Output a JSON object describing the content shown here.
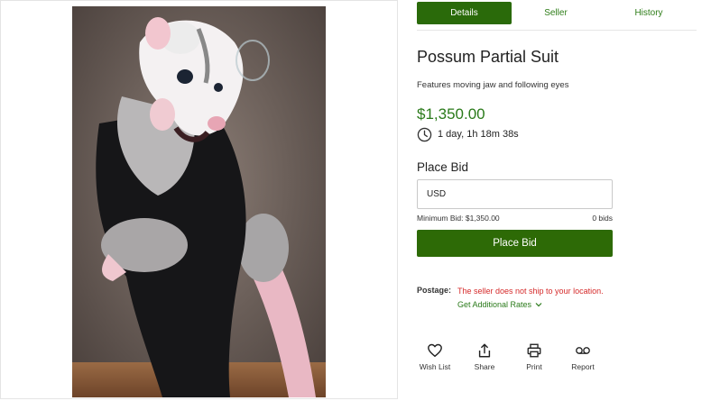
{
  "tabs": [
    {
      "label": "Details",
      "active": true
    },
    {
      "label": "Seller",
      "active": false
    },
    {
      "label": "History",
      "active": false
    }
  ],
  "listing": {
    "title": "Possum Partial Suit",
    "description": "Features moving jaw and following eyes",
    "price": "$1,350.00",
    "time_left": "1 day, 1h 18m 38s",
    "image_icon": "listing-photo"
  },
  "bid": {
    "heading": "Place Bid",
    "placeholder": "USD",
    "minimum_label": "Minimum Bid: $1,350.00",
    "bid_count": "0 bids",
    "button_label": "Place Bid"
  },
  "postage": {
    "label": "Postage:",
    "message": "The seller does not ship to your location.",
    "rates_link": "Get Additional Rates"
  },
  "actions": [
    {
      "label": "Wish List",
      "icon": "heart-icon"
    },
    {
      "label": "Share",
      "icon": "share-icon"
    },
    {
      "label": "Print",
      "icon": "printer-icon"
    },
    {
      "label": "Report",
      "icon": "report-icon"
    }
  ],
  "colors": {
    "accent_green": "#2a6a0a",
    "price_green": "#2a7a1a",
    "warning_red": "#d52a2a"
  }
}
